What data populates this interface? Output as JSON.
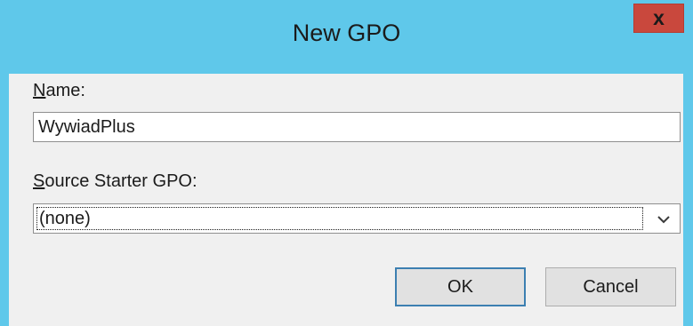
{
  "window": {
    "title": "New GPO",
    "close_label": "x"
  },
  "form": {
    "name_label_key": "N",
    "name_label_rest": "ame:",
    "name_value": "WywiadPlus",
    "source_label_key": "S",
    "source_label_rest": "ource Starter GPO:",
    "source_value": "(none)",
    "chevron_icon": "chevron-down-icon"
  },
  "buttons": {
    "ok_label": "OK",
    "cancel_label": "Cancel"
  },
  "colors": {
    "titlebar": "#5fc8ea",
    "close": "#c9483d",
    "dialog_bg": "#f0f0f0",
    "default_button_border": "#3c7fb1"
  }
}
